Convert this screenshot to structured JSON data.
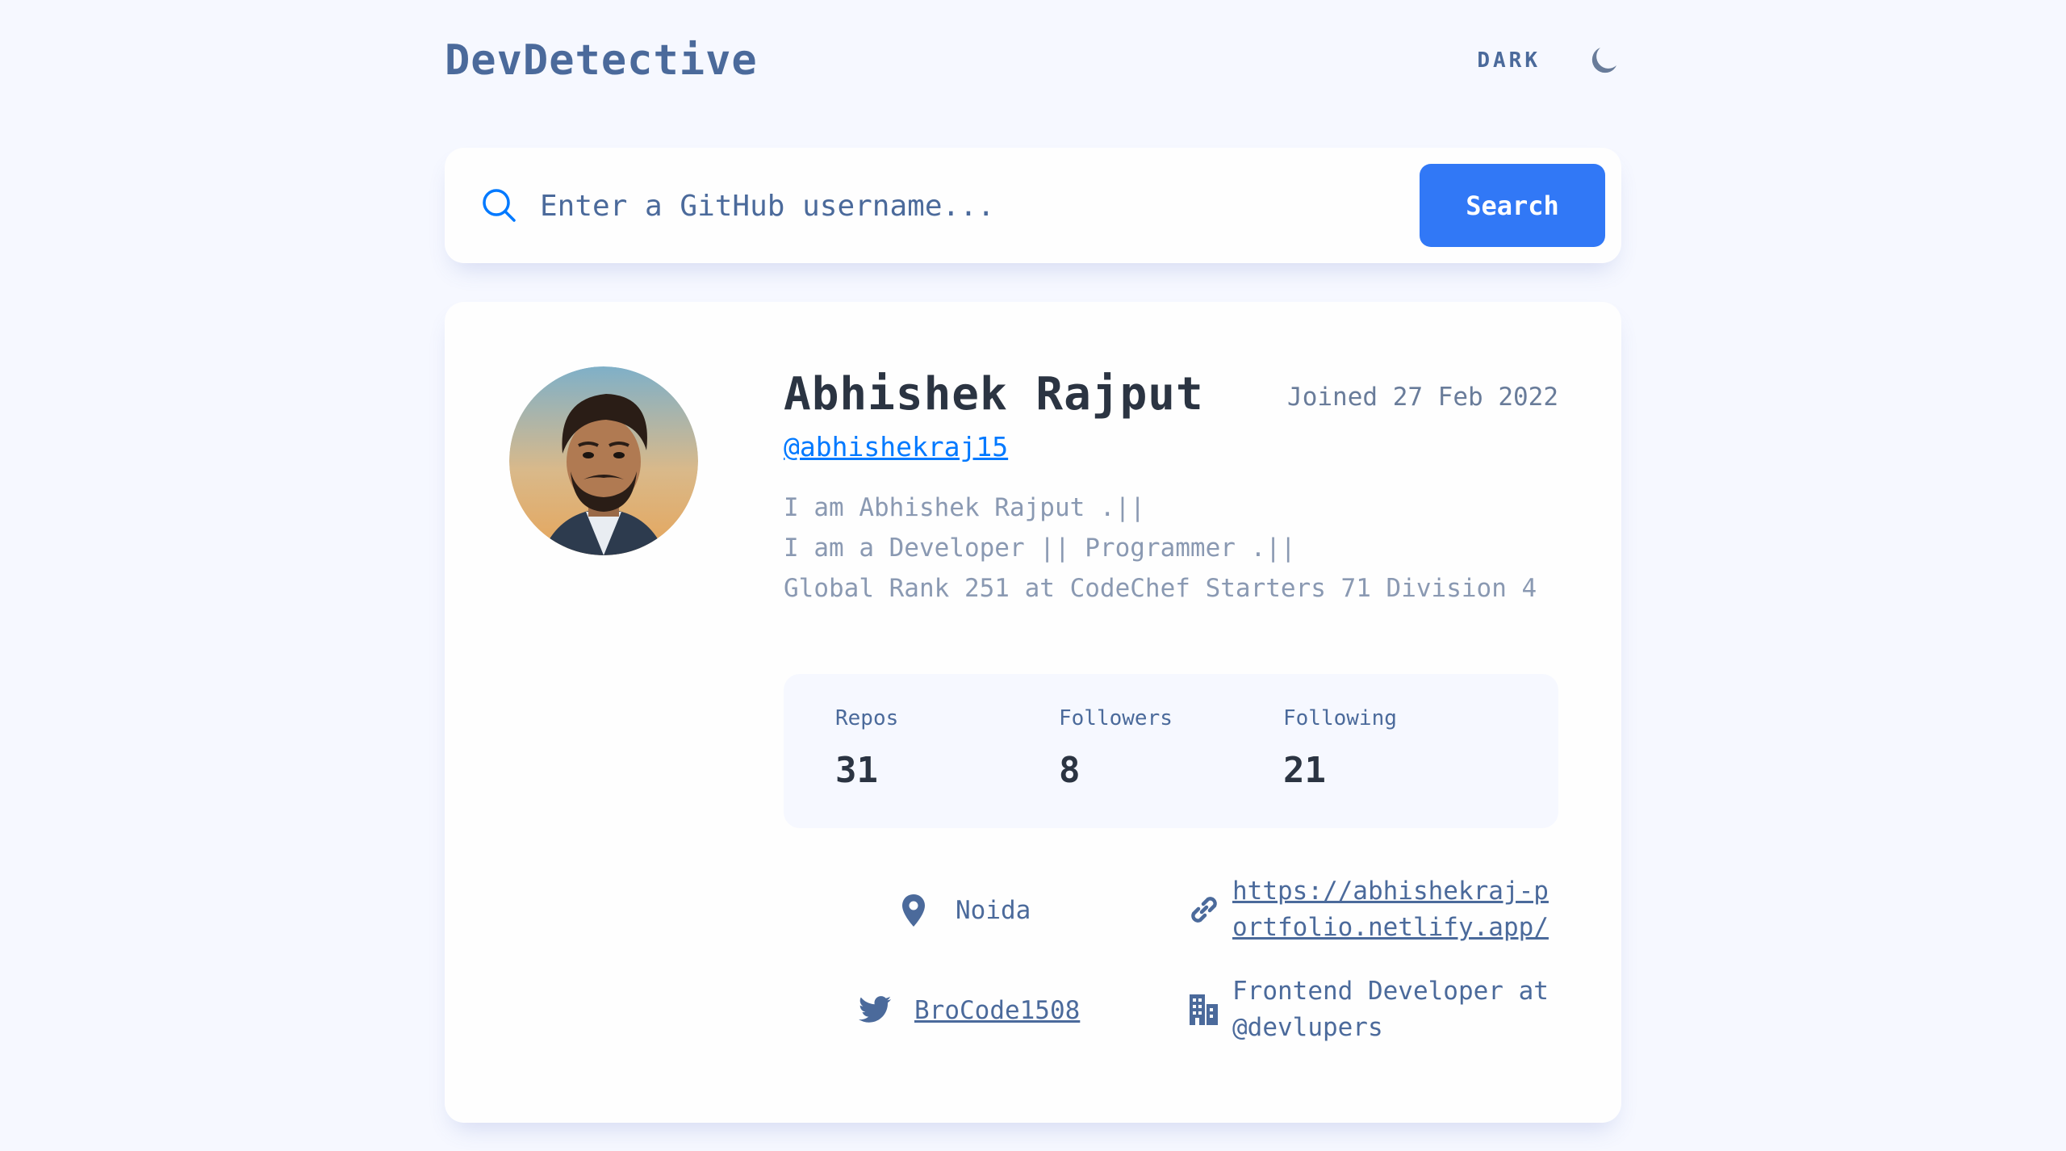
{
  "header": {
    "logo": "DevDetective",
    "theme_label": "DARK",
    "theme_icon": "moon-icon"
  },
  "search": {
    "icon": "search-icon",
    "placeholder": "Enter a GitHub username...",
    "value": "",
    "button_label": "Search"
  },
  "profile": {
    "name": "Abhishek Rajput",
    "joined": "Joined 27 Feb 2022",
    "handle": "@abhishekraj15",
    "bio": [
      "I am Abhishek Rajput .||",
      "I am a Developer || Programmer .||",
      "Global Rank 251 at CodeChef Starters 71 Division 4"
    ],
    "stats": [
      {
        "label": "Repos",
        "value": "31"
      },
      {
        "label": "Followers",
        "value": "8"
      },
      {
        "label": "Following",
        "value": "21"
      }
    ],
    "links": {
      "location": {
        "icon": "location-pin-icon",
        "text": "Noida"
      },
      "website": {
        "icon": "link-icon",
        "line1": "https://abhishekraj-p",
        "line2": "ortfolio.netlify.app/"
      },
      "twitter": {
        "icon": "twitter-icon",
        "text": "BroCode1508"
      },
      "company": {
        "icon": "building-icon",
        "line1": "Frontend Developer at",
        "line2": "@devlupers"
      }
    }
  },
  "colors": {
    "background": "#f6f8ff",
    "card": "#fefefe",
    "accent": "#3178f6",
    "heading": "#2b3442",
    "text": "#4b6a9b",
    "muted": "#8a99b2"
  }
}
